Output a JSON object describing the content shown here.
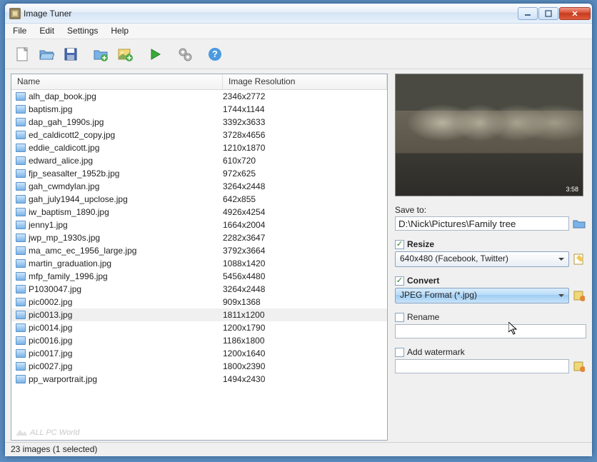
{
  "window": {
    "title": "Image Tuner"
  },
  "menu": {
    "file": "File",
    "edit": "Edit",
    "settings": "Settings",
    "help": "Help"
  },
  "columns": {
    "name": "Name",
    "resolution": "Image Resolution"
  },
  "files": [
    {
      "name": "alh_dap_book.jpg",
      "res": "2346x2772"
    },
    {
      "name": "baptism.jpg",
      "res": "1744x1144"
    },
    {
      "name": "dap_gah_1990s.jpg",
      "res": "3392x3633"
    },
    {
      "name": "ed_caldicott2_copy.jpg",
      "res": "3728x4656"
    },
    {
      "name": "eddie_caldicott.jpg",
      "res": "1210x1870"
    },
    {
      "name": "edward_alice.jpg",
      "res": "610x720"
    },
    {
      "name": "fjp_seasalter_1952b.jpg",
      "res": "972x625"
    },
    {
      "name": "gah_cwmdylan.jpg",
      "res": "3264x2448"
    },
    {
      "name": "gah_july1944_upclose.jpg",
      "res": "642x855"
    },
    {
      "name": "iw_baptism_1890.jpg",
      "res": "4926x4254"
    },
    {
      "name": "jenny1.jpg",
      "res": "1664x2004"
    },
    {
      "name": "jwp_mp_1930s.jpg",
      "res": "2282x3647"
    },
    {
      "name": "ma_amc_ec_1956_large.jpg",
      "res": "3792x3664"
    },
    {
      "name": "martin_graduation.jpg",
      "res": "1088x1420"
    },
    {
      "name": "mfp_family_1996.jpg",
      "res": "5456x4480"
    },
    {
      "name": "P1030047.jpg",
      "res": "3264x2448"
    },
    {
      "name": "pic0002.jpg",
      "res": "909x1368"
    },
    {
      "name": "pic0013.jpg",
      "res": "1811x1200"
    },
    {
      "name": "pic0014.jpg",
      "res": "1200x1790"
    },
    {
      "name": "pic0016.jpg",
      "res": "1186x1800"
    },
    {
      "name": "pic0017.jpg",
      "res": "1200x1640"
    },
    {
      "name": "pic0027.jpg",
      "res": "1800x2390"
    },
    {
      "name": "pp_warportrait.jpg",
      "res": "1494x2430"
    }
  ],
  "selected_index": 17,
  "side": {
    "save_to_label": "Save to:",
    "save_to_path": "D:\\Nick\\Pictures\\Family tree",
    "resize_label": "Resize",
    "resize_value": "640x480 (Facebook, Twitter)",
    "convert_label": "Convert",
    "convert_value": "JPEG Format (*.jpg)",
    "rename_label": "Rename",
    "rename_value": "",
    "watermark_label": "Add watermark",
    "watermark_value": ""
  },
  "status": "23 images (1 selected)",
  "branding": "ALL PC World",
  "preview_stamp": "3:58"
}
